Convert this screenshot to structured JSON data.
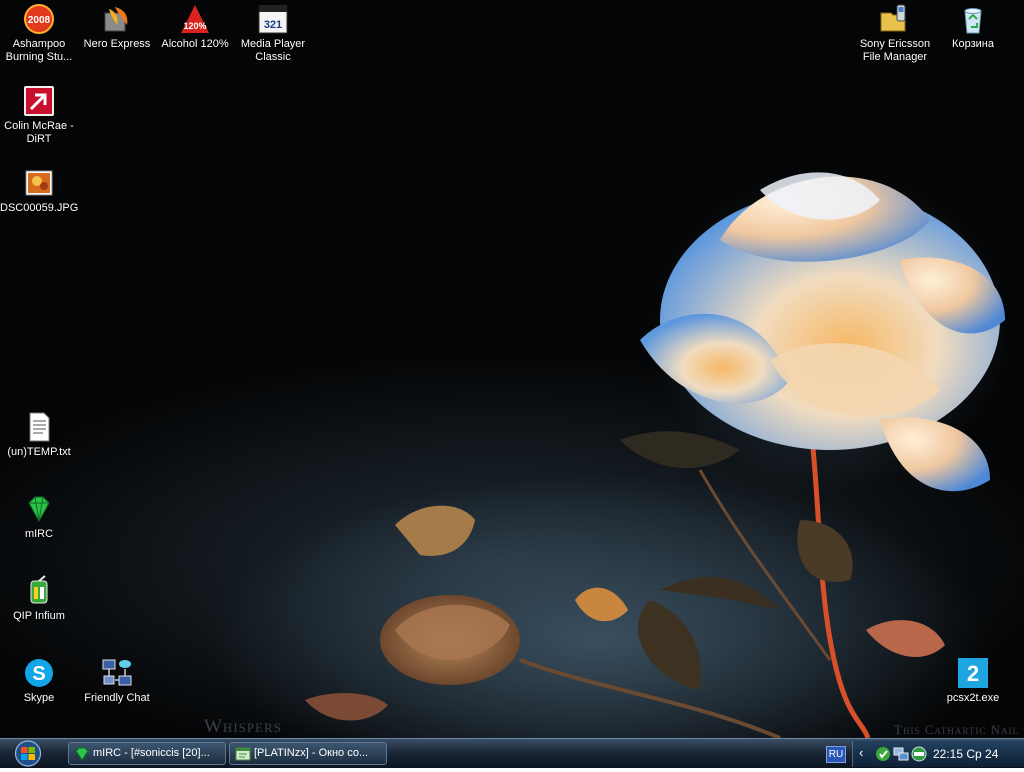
{
  "desktop": {
    "icons": [
      {
        "name": "ashampoo-icon",
        "label": "Ashampoo Burning Stu..."
      },
      {
        "name": "nero-express-icon",
        "label": "Nero Express"
      },
      {
        "name": "alcohol-120-icon",
        "label": "Alcohol 120%"
      },
      {
        "name": "media-player-classic-icon",
        "label": "Media Player Classic"
      },
      {
        "name": "colin-mcrae-dirt-icon",
        "label": "Colin McRae - DiRT"
      },
      {
        "name": "jpg-image-icon",
        "label": "DSC00059.JPG"
      },
      {
        "name": "text-file-icon",
        "label": "(un)TEMP.txt"
      },
      {
        "name": "mirc-icon",
        "label": "mIRC"
      },
      {
        "name": "qip-infium-icon",
        "label": "QIP Infium"
      },
      {
        "name": "skype-icon",
        "label": "Skype"
      },
      {
        "name": "friendly-chat-icon",
        "label": "Friendly Chat"
      },
      {
        "name": "sony-ericsson-icon",
        "label": "Sony Ericsson File Manager"
      },
      {
        "name": "recycle-bin-icon",
        "label": "Корзина"
      },
      {
        "name": "pcsx2-exe-icon",
        "label": "pcsx2t.exe"
      }
    ],
    "ashampoo_badge": "2008",
    "alcohol_badge": "120%",
    "mpc_badge": "321",
    "pcsx2_badge": "2",
    "wallpaper": {
      "watermark_left": "Whispers",
      "watermark_right": "This Cathartic Nail"
    }
  },
  "taskbar": {
    "start_icon": "windows-logo-icon",
    "tasks": [
      {
        "name": "mirc-task-icon",
        "label": "mIRC - [#soniccis [20]..."
      },
      {
        "name": "document-task-icon",
        "label": "[PLATINzx] - Окно со..."
      }
    ],
    "language": "RU",
    "tray_expand": "‹",
    "tray_icons": [
      "qip-tray-icon",
      "network-tray-icon",
      "antivirus-tray-icon"
    ],
    "clock": "22:15 Ср 24"
  },
  "colors": {
    "taskbar_top": "#3a4e66",
    "taskbar_bottom": "#0c1420",
    "tray": "#22415f",
    "language_badge": "#2b58b8"
  }
}
